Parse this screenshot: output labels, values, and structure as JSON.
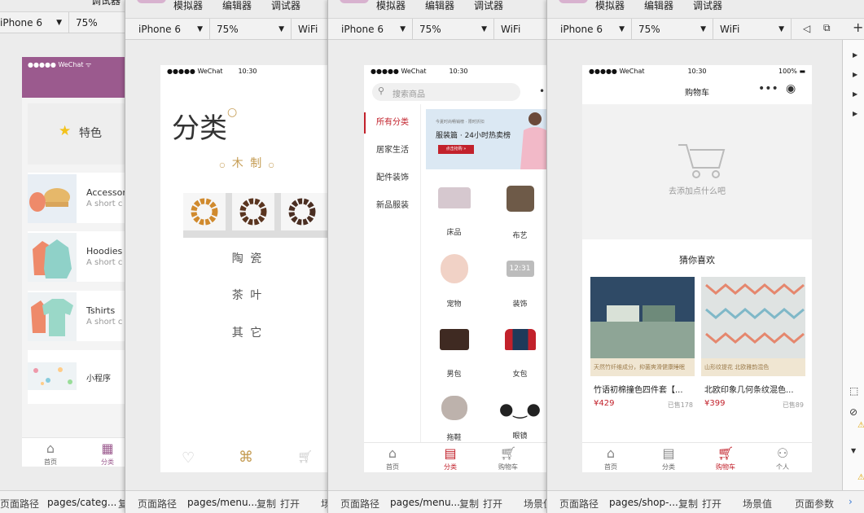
{
  "menu": {
    "simulator": "模拟器",
    "editor": "编辑器",
    "debugger": "调试器"
  },
  "toolbar": {
    "device": "iPhone 6",
    "zoom": "75%",
    "network": "WiFi"
  },
  "statusbar": {
    "path_label": "页面路径",
    "path1": "pages/categ...",
    "path2": "pages/menu...",
    "path3": "pages/menu...",
    "path4": "pages/shop-...",
    "copy": "复制",
    "open": "打开",
    "scene": "场景值",
    "params": "页面参数",
    "scene_short": "场",
    "extra_short": "复"
  },
  "wechat_status": {
    "carrier": "●●●●● WeChat",
    "time": "10:30",
    "battery": "100%"
  },
  "panel1": {
    "header": "●●●●● WeChat",
    "featured": "特色",
    "items": [
      {
        "title": "Accessor",
        "sub": "A short c"
      },
      {
        "title": "Hoodies",
        "sub": "A short c"
      },
      {
        "title": "Tshirts",
        "sub": "A short c"
      }
    ],
    "miniprogram": "小程序",
    "tabs": [
      {
        "label": "首页"
      },
      {
        "label": "分类"
      }
    ]
  },
  "panel2": {
    "title": "分类",
    "subtitle": "木 制",
    "cats": [
      "陶 瓷",
      "茶 叶",
      "其 它"
    ]
  },
  "panel3": {
    "search_placeholder": "搜索商品",
    "side": [
      "所有分类",
      "居家生活",
      "配件装饰",
      "新品服装"
    ],
    "banner_small": "今夏时尚畅销榜 · 限时折扣",
    "banner_title": "服装篇 · 24小时热卖榜",
    "banner_btn": "点击抢购 »",
    "products": [
      "床品",
      "布艺",
      "宠物",
      "装饰",
      "男包",
      "女包",
      "拖鞋",
      "眼镜"
    ],
    "tabs": [
      {
        "label": "首页"
      },
      {
        "label": "分类"
      },
      {
        "label": "购物车"
      }
    ]
  },
  "panel4": {
    "title": "购物车",
    "empty": "去添加点什么吧",
    "guess": "猜你喜欢",
    "cards": [
      {
        "tag": "天然竹纤维成分，抑菌爽滑健康睡眠",
        "name": "竹语初棉撞色四件套【...",
        "price": "¥429",
        "sold": "已售178"
      },
      {
        "tag": "山形纹提花 北欧雅韵混色",
        "name": "北欧印象几何条纹混色...",
        "price": "¥399",
        "sold": "已售89"
      }
    ],
    "tabs": [
      {
        "label": "首页"
      },
      {
        "label": "分类"
      },
      {
        "label": "购物车"
      },
      {
        "label": "个人"
      }
    ]
  },
  "colors": {
    "accent": "#c2212b",
    "purple": "#9b5a8e",
    "gold": "#c49b52"
  }
}
